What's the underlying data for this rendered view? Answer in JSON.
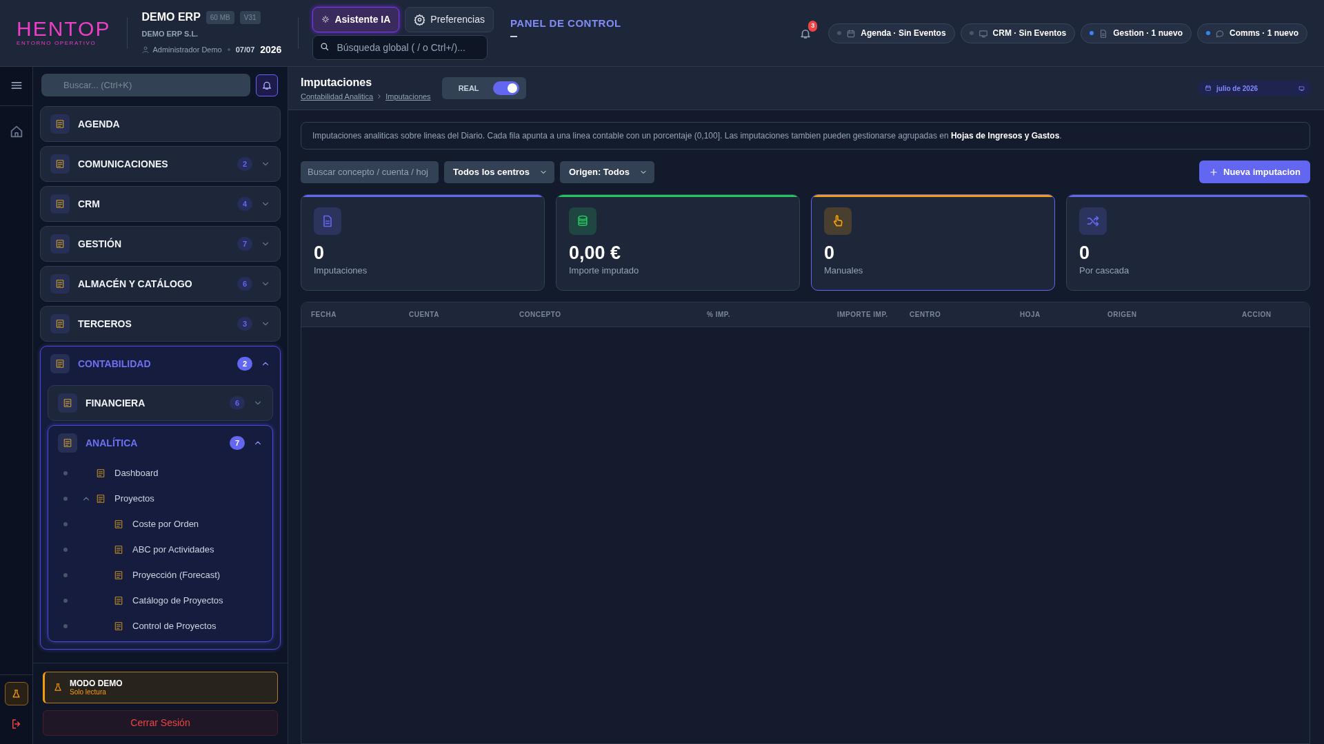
{
  "header": {
    "logo": {
      "name": "HENTOP",
      "tagline": "ENTORNO OPERATIVO"
    },
    "company": {
      "name": "DEMO ERP",
      "badges": [
        "60 MB",
        "V31"
      ],
      "legal_name": "DEMO ERP S.L.",
      "user": "Administrador Demo",
      "date": "07/07",
      "year": "2026"
    },
    "buttons": [
      {
        "label": "Asistente IA",
        "kind": "ai"
      },
      {
        "label": "Preferencias",
        "kind": "settings"
      }
    ],
    "search": {
      "placeholder": "Búsqueda global ( / o Ctrl+/)..."
    },
    "panel_link": "PANEL DE CONTROL",
    "notifications": "3",
    "status_pills": [
      {
        "label": "Agenda · Sin Eventos",
        "kind": "calendar",
        "active": false
      },
      {
        "label": "CRM · Sin Eventos",
        "kind": "monitor",
        "active": false
      },
      {
        "label": "Gestion · 1 nuevo",
        "kind": "document",
        "active": true
      },
      {
        "label": "Comms · 1 nuevo",
        "kind": "chat",
        "active": true
      }
    ]
  },
  "sidebar": {
    "search": {
      "placeholder": "Buscar... (Ctrl+K)"
    },
    "sections": [
      {
        "label": "AGENDA"
      },
      {
        "label": "COMUNICACIONES",
        "count": "2",
        "expanded": false
      },
      {
        "label": "CRM",
        "count": "4",
        "expanded": false
      },
      {
        "label": "GESTIÓN",
        "count": "7",
        "expanded": false
      },
      {
        "label": "ALMACÉN Y CATÁLOGO",
        "count": "6",
        "expanded": false
      },
      {
        "label": "TERCEROS",
        "count": "3",
        "expanded": false
      },
      {
        "label": "CONTABILIDAD",
        "count": "2",
        "expanded": true,
        "children": [
          {
            "label": "FINANCIERA",
            "count": "6",
            "expanded": false
          },
          {
            "label": "ANALÍTICA",
            "count": "7",
            "expanded": true,
            "children": [
              {
                "label": "Dashboard"
              },
              {
                "label": "Proyectos",
                "expanded": true,
                "children": [
                  {
                    "label": "Coste por Orden"
                  },
                  {
                    "label": "ABC por Actividades"
                  },
                  {
                    "label": "Proyección (Forecast)"
                  },
                  {
                    "label": "Catálogo de Proyectos"
                  },
                  {
                    "label": "Control de Proyectos"
                  }
                ]
              }
            ]
          }
        ]
      }
    ],
    "demo": {
      "title": "MODO DEMO",
      "subtitle": "Solo lectura"
    },
    "logout": "Cerrar Sesión"
  },
  "page": {
    "title": "Imputaciones",
    "breadcrumb": [
      "Contabilidad Analitica",
      "Imputaciones"
    ],
    "toggle": {
      "label": "REAL",
      "on": true
    },
    "period": "julio de 2026",
    "info": "Imputaciones analiticas sobre lineas del Diario. Cada fila apunta a una linea contable con un porcentaje (0,100]. Las imputaciones tambien pueden gestionarse agrupadas en **Hojas de Ingresos y Gastos**.",
    "filters": {
      "search": {
        "placeholder": "Buscar concepto / cuenta / hoj"
      },
      "selects": [
        "Todos los centros",
        "Origen: Todos"
      ]
    },
    "new_button": "Nueva imputacion",
    "stats": [
      {
        "value": "0",
        "label": "Imputaciones",
        "kind": "document",
        "color": "#6366f1",
        "selected": false
      },
      {
        "value": "0,00 €",
        "label": "Importe imputado",
        "kind": "coins",
        "color": "#22c55e",
        "selected": false
      },
      {
        "value": "0",
        "label": "Manuales",
        "kind": "hand",
        "color": "#f59e0b",
        "selected": true
      },
      {
        "value": "0",
        "label": "Por cascada",
        "kind": "shuffle",
        "color": "#6366f1",
        "selected": false
      }
    ],
    "table": {
      "columns": [
        "FECHA",
        "CUENTA",
        "CONCEPTO",
        "% IMP.",
        "IMPORTE IMP.",
        "CENTRO",
        "HOJA",
        "ORIGEN",
        "ACCION"
      ]
    }
  }
}
